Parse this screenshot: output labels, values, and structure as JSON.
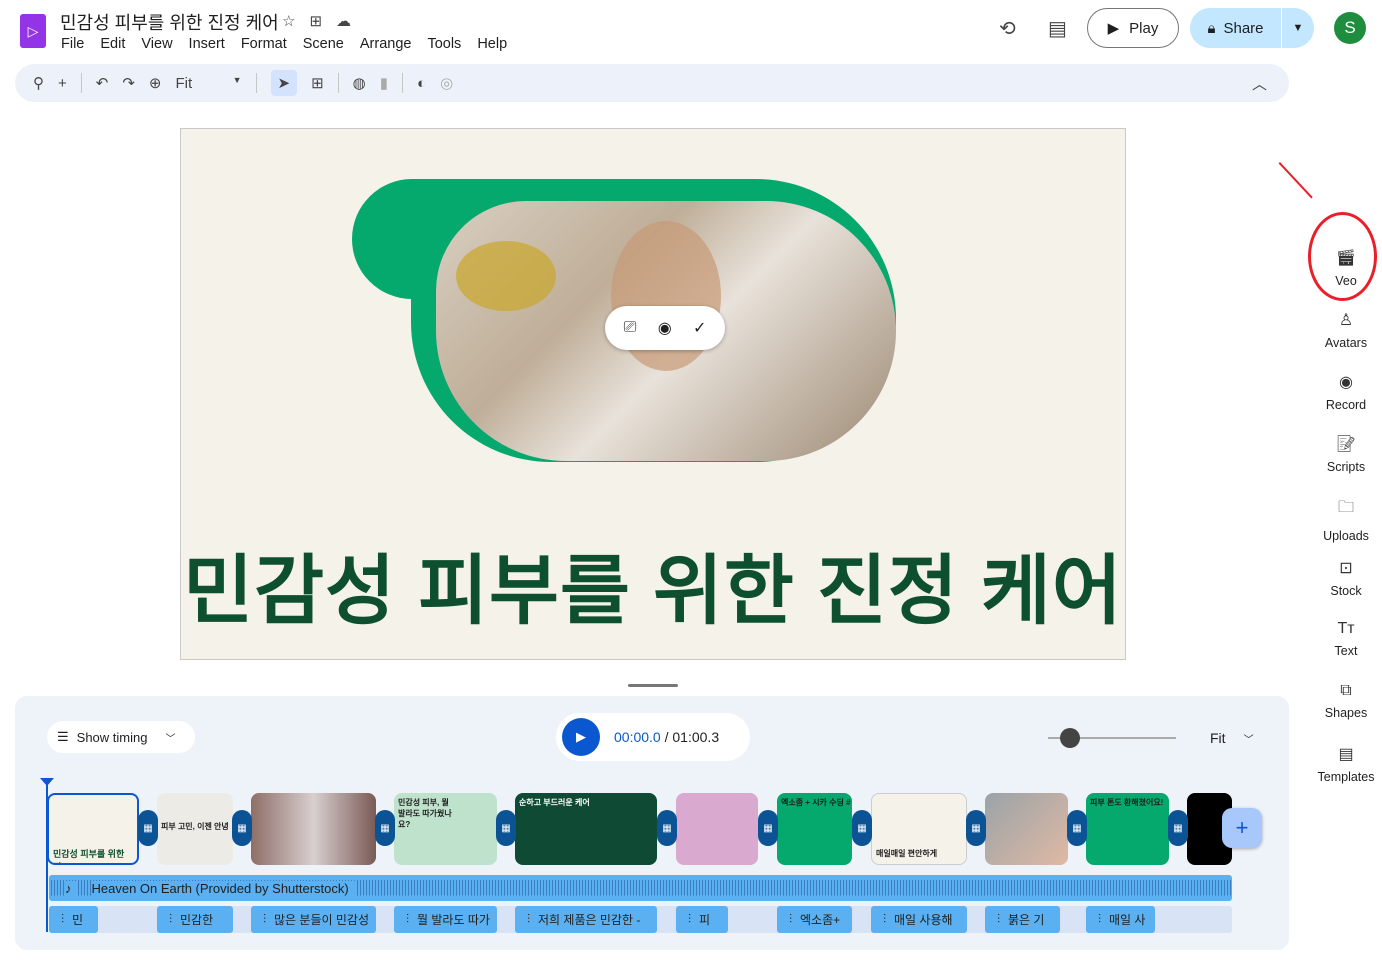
{
  "header": {
    "title": "민감성 피부를 위한 진정 케어",
    "menu": [
      "File",
      "Edit",
      "View",
      "Insert",
      "Format",
      "Scene",
      "Arrange",
      "Tools",
      "Help"
    ],
    "play_label": "Play",
    "share_label": "Share",
    "avatar_letter": "S"
  },
  "toolbar": {
    "zoom_value": "Fit"
  },
  "slide": {
    "title": "민감성 피부를 위한 진정 케어"
  },
  "side_panel": [
    "Veo",
    "Avatars",
    "Record",
    "Scripts",
    "Uploads",
    "Stock",
    "Text",
    "Shapes",
    "Templates"
  ],
  "timeline": {
    "show_timing": "Show timing",
    "current_time": "00:00.0",
    "separator": "/",
    "total_time": "01:00.3",
    "zoom_label": "Fit",
    "scenes": [
      "민감성 피부를 위한 진",
      "피부 고민, 이젠 안녕",
      "",
      "민감성 피부, 뭘 발라도 따가웠나요?",
      "순하고 부드러운 케어",
      "",
      "엑소좀 + 시카 수딩 #",
      "매일매일 편안하게",
      "",
      "피부 톤도 환해졌어요!",
      ""
    ],
    "music": "Heaven On Earth (Provided by Shutterstock)",
    "voice_clips": [
      "민",
      "민감한",
      "많은 분들이 민감성",
      "뭘 발라도 따가",
      "저희 제품은 민감한 -",
      "피",
      "엑소좀+",
      "매일 사용해",
      "붉은 기",
      "매일 사"
    ]
  },
  "colors": {
    "accent": "#0b57d0",
    "brand_green": "#05a86d",
    "title_green": "#0d4f2e"
  }
}
